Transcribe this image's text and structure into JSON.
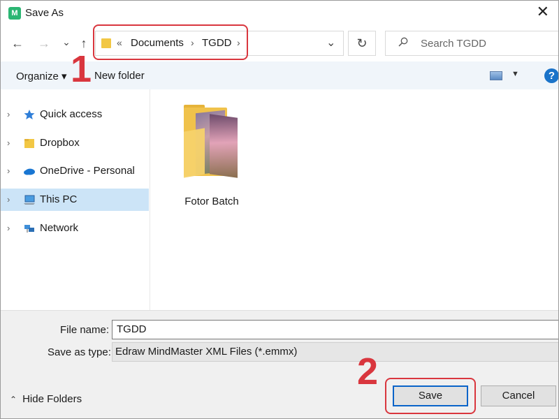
{
  "window": {
    "app_icon_glyph": "M",
    "title": "Save As",
    "close_glyph": "✕"
  },
  "navigation": {
    "back_glyph": "←",
    "forward_glyph": "→",
    "recent_glyph": "⌄",
    "up_glyph": "↑",
    "breadcrumb_overflow": "«",
    "breadcrumbs": [
      "Documents",
      "TGDD"
    ],
    "crumb_separator": "›",
    "dropdown_glyph": "⌄",
    "refresh_glyph": "↻",
    "search_placeholder": "Search TGDD"
  },
  "commandbar": {
    "organize_label": "Organize ▾",
    "new_folder_label": "New folder",
    "view_caret": "▼",
    "help_glyph": "?"
  },
  "sidebar": {
    "items": [
      {
        "label": "Quick access",
        "icon": "star-icon",
        "selected": false
      },
      {
        "label": "Dropbox",
        "icon": "folder-icon",
        "selected": false
      },
      {
        "label": "OneDrive - Personal",
        "icon": "cloud-icon",
        "selected": false
      },
      {
        "label": "This PC",
        "icon": "computer-icon",
        "selected": true
      },
      {
        "label": "Network",
        "icon": "network-icon",
        "selected": false
      }
    ],
    "chevron_glyph": "›"
  },
  "content": {
    "items": [
      {
        "label": "Fotor Batch",
        "icon": "folder-icon"
      }
    ]
  },
  "form": {
    "file_name_label": "File name:",
    "file_name_value": "TGDD",
    "save_type_label": "Save as type:",
    "save_type_value": "Edraw MindMaster XML Files (*.emmx)",
    "hide_folders_caret": "⌃",
    "hide_folders_label": "Hide Folders",
    "save_label": "Save",
    "cancel_label": "Cancel"
  },
  "annotations": {
    "step1": "1",
    "step2": "2"
  },
  "colors": {
    "accent_blue": "#0a64c9",
    "annotation_red": "#d9363e",
    "selection": "#cce4f7",
    "commandbar_bg": "#f0f5fa"
  }
}
